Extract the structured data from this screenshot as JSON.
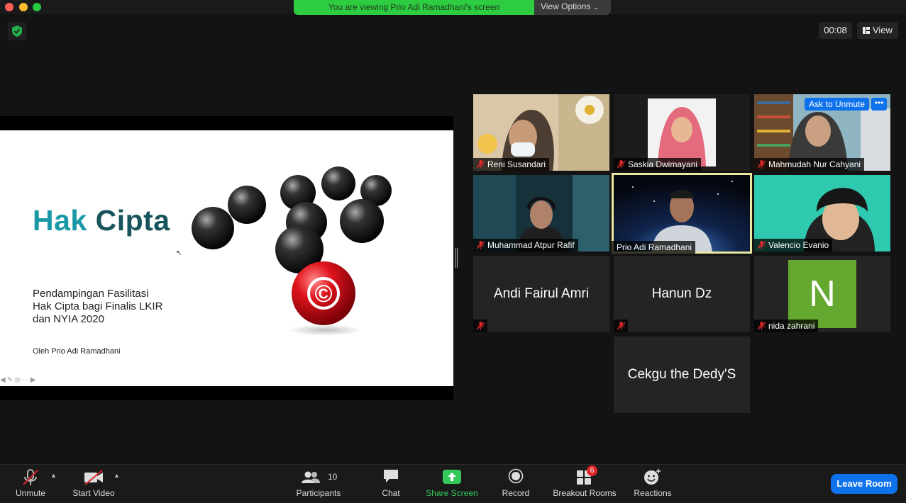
{
  "banner": {
    "viewing": "You are viewing Prio Adi Ramadhani's screen",
    "view_options": "View Options"
  },
  "top_right": {
    "timer": "00:08",
    "view_label": "View"
  },
  "slide": {
    "title_part1": "Hak ",
    "title_part2": "Cipta",
    "subtitle_line1": "Pendampingan Fasilitasi",
    "subtitle_line2": "Hak Cipta bagi Finalis LKIR",
    "subtitle_line3": "dan NYIA 2020",
    "author": "Oleh Prio Adi Ramadhani",
    "copyright_symbol": "©"
  },
  "participants": [
    {
      "name": "Reni Susandari",
      "muted": true,
      "video": true
    },
    {
      "name": "Saskia Dwimayani",
      "muted": true,
      "video": true
    },
    {
      "name": "Mahmudah Nur Cahyani",
      "muted": true,
      "video": true,
      "ask_to_unmute": "Ask to Unmute",
      "more": "•••"
    },
    {
      "name": "Muhammad Atpur Rafif",
      "muted": true,
      "video": true
    },
    {
      "name": "Prio Adi Ramadhani",
      "muted": false,
      "video": true,
      "active_speaker": true
    },
    {
      "name": "Valencio Evanio",
      "muted": true,
      "video": true
    },
    {
      "name": "Andi Fairul Amri",
      "muted": true,
      "video": false
    },
    {
      "name": "Hanun Dz",
      "muted": true,
      "video": false
    },
    {
      "name": "nida zahrani",
      "muted": true,
      "video": false,
      "avatar_letter": "N",
      "avatar_color": "#65a82f"
    },
    {
      "name": "Cekgu the Dedy'S",
      "muted": false,
      "video": false
    }
  ],
  "toolbar": {
    "unmute": "Unmute",
    "start_video": "Start Video",
    "participants": "Participants",
    "participant_count": "10",
    "chat": "Chat",
    "share_screen": "Share Screen",
    "record": "Record",
    "breakout_rooms": "Breakout Rooms",
    "breakout_badge": "6",
    "reactions": "Reactions",
    "leave": "Leave Room"
  },
  "colors": {
    "accent_blue": "#0e72ed",
    "share_green": "#34c759",
    "banner_green": "#2ecc40",
    "title_teal": "#1a98a6"
  }
}
